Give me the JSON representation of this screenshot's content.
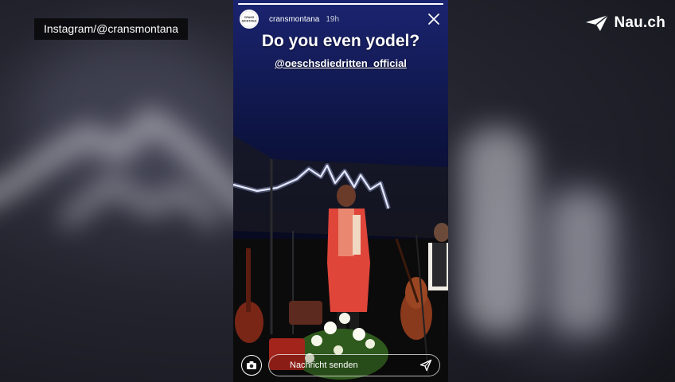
{
  "overlay": {
    "source": "Instagram/@cransmontana",
    "brand": "Nau.ch",
    "brand_icon": "paper-plane-icon"
  },
  "story": {
    "username": "cransmontana",
    "time_ago": "19h",
    "avatar_text": [
      "CRANS",
      "MONTANA"
    ],
    "caption": "Do you even yodel?",
    "mention": "@oeschsdiedritten_official",
    "reply_placeholder": "Nachricht senden",
    "progress": 1.0,
    "icons": {
      "close": "close-icon",
      "camera": "camera-icon",
      "send": "send-icon"
    }
  },
  "colors": {
    "stage_bg": "#0b0f2e",
    "singer_vest": "#e0453a",
    "overlay_tag_bg": "#0a0a0c"
  }
}
